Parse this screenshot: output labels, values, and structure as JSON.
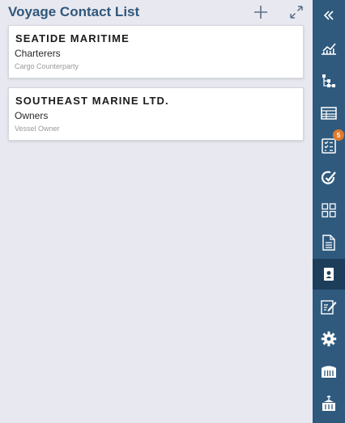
{
  "header": {
    "title": "Voyage Contact List",
    "add_icon": "plus-icon",
    "expand_icon": "expand-icon"
  },
  "contacts": [
    {
      "name": "SEATIDE MARITIME",
      "role": "Charterers",
      "type": "Cargo Counterparty"
    },
    {
      "name": "SOUTHEAST MARINE LTD.",
      "role": "Owners",
      "type": "Vessel Owner"
    }
  ],
  "sidebar": {
    "items": [
      {
        "icon": "collapse-double-chevron-icon"
      },
      {
        "icon": "chart-icon"
      },
      {
        "icon": "hierarchy-icon"
      },
      {
        "icon": "ledger-icon"
      },
      {
        "icon": "checklist-icon",
        "badge": "5"
      },
      {
        "icon": "refresh-check-icon"
      },
      {
        "icon": "grid-icon"
      },
      {
        "icon": "document-icon"
      },
      {
        "icon": "contact-card-icon",
        "active": true
      },
      {
        "icon": "edit-note-icon"
      },
      {
        "icon": "gear-icon"
      },
      {
        "icon": "container-icon"
      },
      {
        "icon": "cargo-lift-icon"
      }
    ]
  },
  "colors": {
    "title": "#30577a",
    "sidebar": "#2f5a7e",
    "sidebar_active": "#1d3e5b",
    "badge": "#e07a2b",
    "background": "#e8e9f0"
  }
}
